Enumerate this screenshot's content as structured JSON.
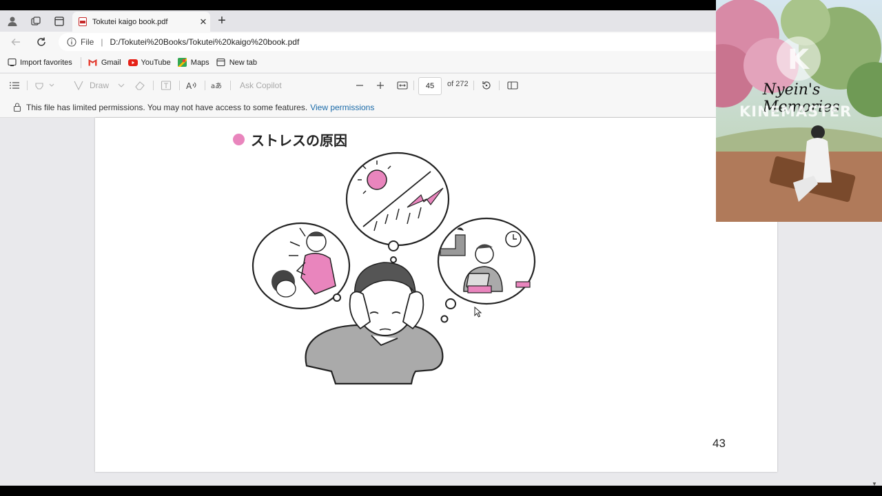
{
  "browser": {
    "tab": {
      "title": "Tokutei kaigo book.pdf"
    },
    "address": {
      "scheme": "File",
      "url": "D:/Tokutei%20Books/Tokutei%20kaigo%20book.pdf"
    },
    "favorites": [
      {
        "label": "Import favorites",
        "icon": "import-icon"
      },
      {
        "label": "Gmail",
        "icon": "gmail-icon"
      },
      {
        "label": "YouTube",
        "icon": "youtube-icon"
      },
      {
        "label": "Maps",
        "icon": "maps-icon"
      },
      {
        "label": "New tab",
        "icon": "newtab-icon"
      }
    ]
  },
  "pdf_toolbar": {
    "draw_label": "Draw",
    "copilot_label": "Ask Copilot",
    "page_current": "45",
    "page_total": "of 272"
  },
  "permission_bar": {
    "message": "This file has limited permissions. You may not have access to some features.",
    "link": "View permissions"
  },
  "document": {
    "heading": "ストレスの原因",
    "page_number": "43",
    "accent_color": "#e985bd"
  },
  "overlay": {
    "title": "Nyein's Memories",
    "brand": "KINEMASTER"
  }
}
